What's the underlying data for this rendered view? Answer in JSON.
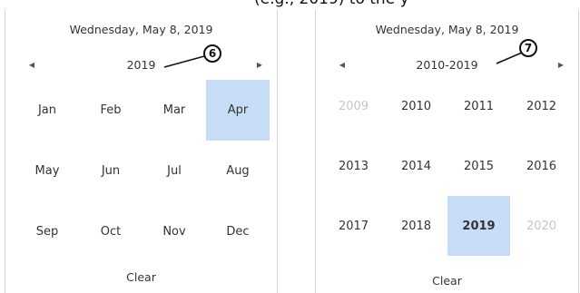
{
  "top_text": "(e.g., 2019) to the y",
  "left_calendar": {
    "date_header": "Wednesday, May 8, 2019",
    "nav_title": "2019",
    "callout": "6",
    "cells": [
      {
        "label": "Jan"
      },
      {
        "label": "Feb"
      },
      {
        "label": "Mar"
      },
      {
        "label": "Apr",
        "selected": true
      },
      {
        "label": "May"
      },
      {
        "label": "Jun"
      },
      {
        "label": "Jul"
      },
      {
        "label": "Aug"
      },
      {
        "label": "Sep"
      },
      {
        "label": "Oct"
      },
      {
        "label": "Nov"
      },
      {
        "label": "Dec"
      }
    ],
    "clear_label": "Clear"
  },
  "right_calendar": {
    "date_header": "Wednesday, May 8, 2019",
    "nav_title": "2010-2019",
    "callout": "7",
    "cells": [
      {
        "label": "2009",
        "dim": true
      },
      {
        "label": "2010"
      },
      {
        "label": "2011"
      },
      {
        "label": "2012"
      },
      {
        "label": "2013"
      },
      {
        "label": "2014"
      },
      {
        "label": "2015"
      },
      {
        "label": "2016"
      },
      {
        "label": "2017"
      },
      {
        "label": "2018"
      },
      {
        "label": "2019",
        "selected": true
      },
      {
        "label": "2020",
        "dim": true
      }
    ],
    "clear_label": "Clear"
  },
  "icons": {
    "prev": "chevron-left-icon",
    "next": "chevron-right-icon"
  },
  "colors": {
    "selected_bg": "#c7dcf7",
    "dim_text": "#c6c6c6",
    "border": "#d4d4d4"
  }
}
